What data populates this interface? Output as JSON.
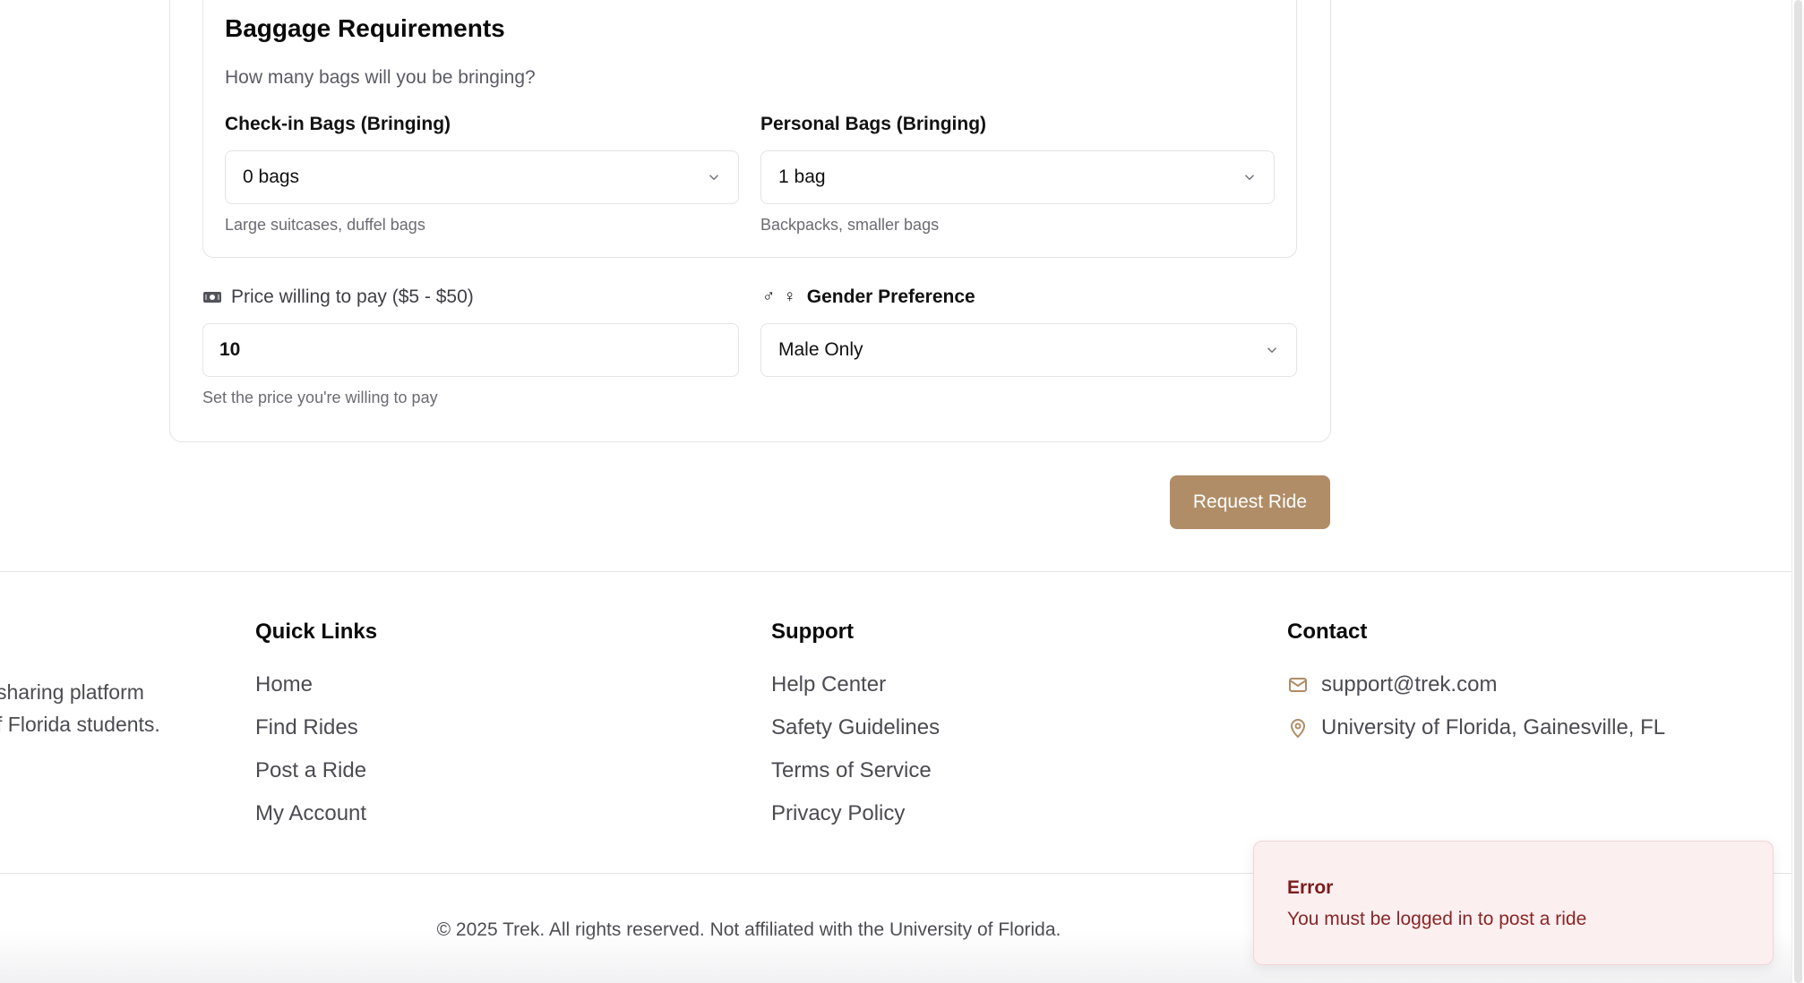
{
  "baggage": {
    "heading": "Baggage Requirements",
    "subtitle": "How many bags will you be bringing?",
    "checkin": {
      "label": "Check-in Bags (Bringing)",
      "value": "0 bags",
      "hint": "Large suitcases, duffel bags"
    },
    "personal": {
      "label": "Personal Bags (Bringing)",
      "value": "1 bag",
      "hint": "Backpacks, smaller bags"
    }
  },
  "price": {
    "icon": "money-icon",
    "label": "Price willing to pay ($5 - $50)",
    "value": "10",
    "hint": "Set the price you're willing to pay"
  },
  "gender": {
    "icon_text": "♂ ♀",
    "label": "Gender Preference",
    "value": "Male Only"
  },
  "actions": {
    "request_label": "Request Ride"
  },
  "footer": {
    "about_line1": "sharing platform",
    "about_line2": "f Florida students.",
    "quick_links": {
      "heading": "Quick Links",
      "items": [
        "Home",
        "Find Rides",
        "Post a Ride",
        "My Account"
      ]
    },
    "support": {
      "heading": "Support",
      "items": [
        "Help Center",
        "Safety Guidelines",
        "Terms of Service",
        "Privacy Policy"
      ]
    },
    "contact": {
      "heading": "Contact",
      "email": "support@trek.com",
      "location": "University of Florida, Gainesville, FL"
    },
    "copyright": "© 2025 Trek. All rights reserved. Not affiliated with the University of Florida."
  },
  "toast": {
    "title": "Error",
    "message": "You must be logged in to post a ride"
  },
  "colors": {
    "accent": "#b08d67",
    "error_bg": "#fbeff0",
    "error_text": "#7a1d1d"
  }
}
